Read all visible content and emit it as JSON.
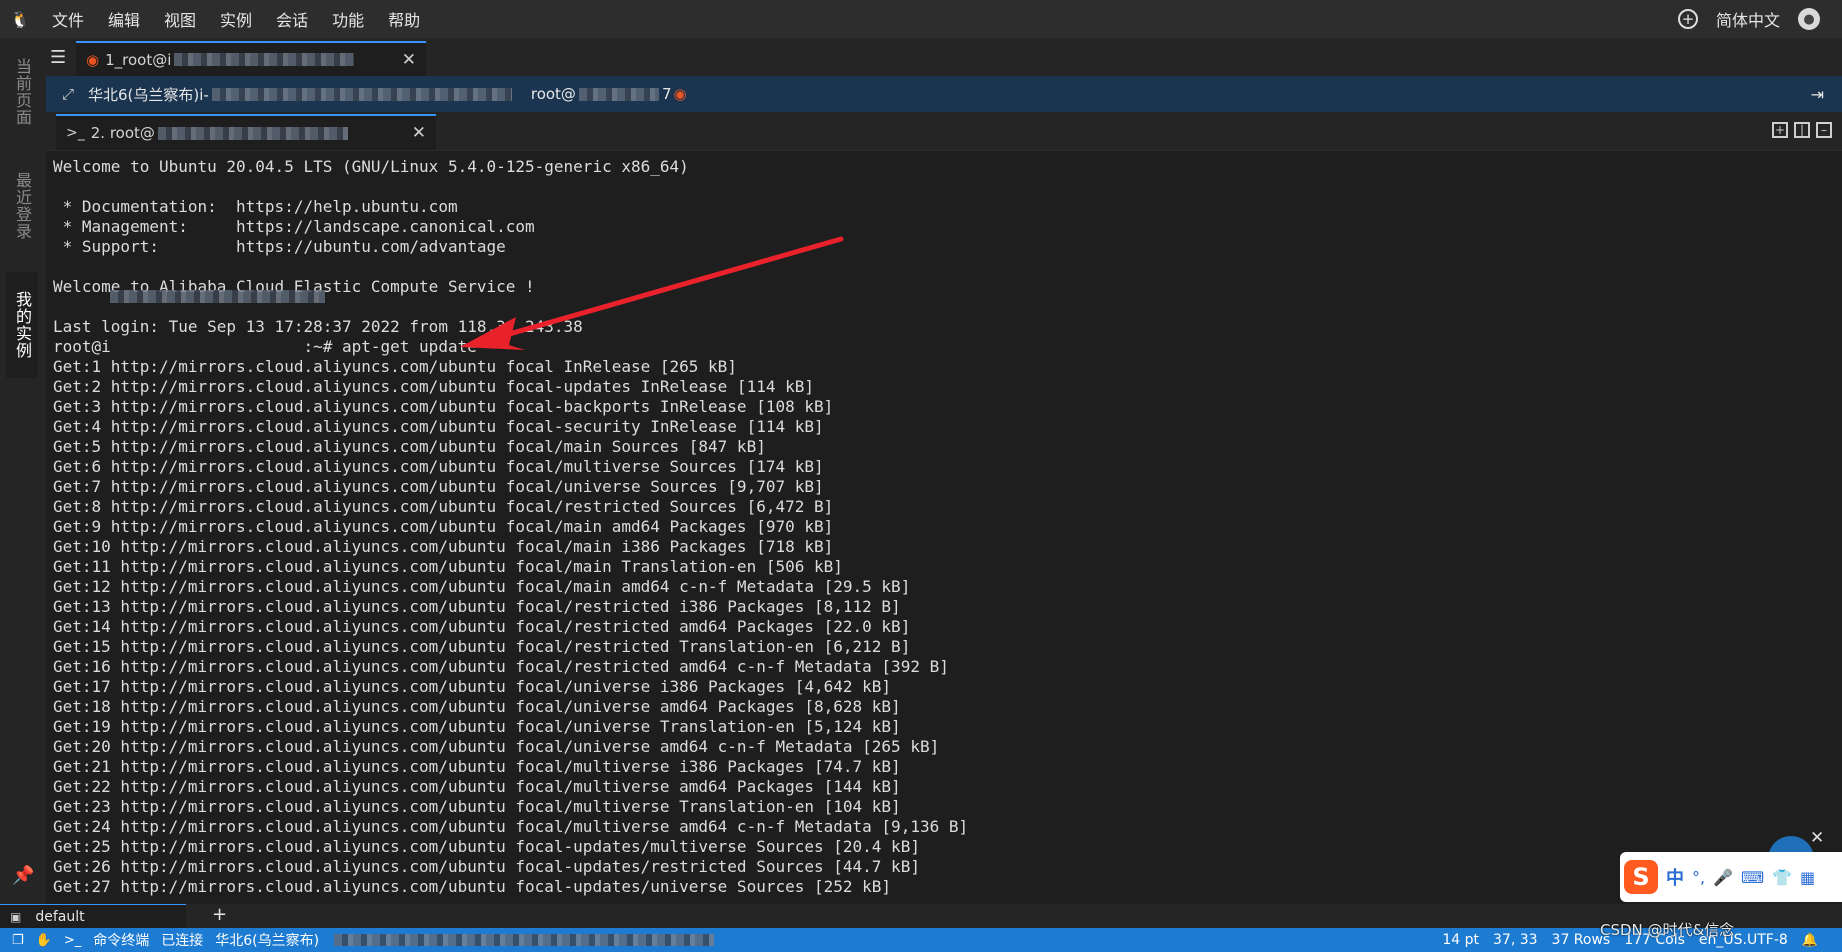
{
  "menu": {
    "items": [
      "文件",
      "编辑",
      "视图",
      "实例",
      "会话",
      "功能",
      "帮助"
    ],
    "language": "简体中文"
  },
  "sidebar": {
    "tabs": [
      "当前页面",
      "最近登录",
      "我的实例"
    ],
    "active": "我的实例"
  },
  "session_tab": {
    "label_prefix": "1_root@i"
  },
  "host_bar": {
    "region": "华北6(乌兰察布)i-",
    "user_prefix": "root@",
    "user_suffix": "7"
  },
  "terminal_tab": {
    "label_prefix": "2. root@"
  },
  "terminal": {
    "lines": [
      "Welcome to Ubuntu 20.04.5 LTS (GNU/Linux 5.4.0-125-generic x86_64)",
      "",
      " * Documentation:  https://help.ubuntu.com",
      " * Management:     https://landscape.canonical.com",
      " * Support:        https://ubuntu.com/advantage",
      "",
      "Welcome to Alibaba Cloud Elastic Compute Service !",
      "",
      "Last login: Tue Sep 13 17:28:37 2022 from 118.31.243.38",
      "root@i                    :~# apt-get update",
      "Get:1 http://mirrors.cloud.aliyuncs.com/ubuntu focal InRelease [265 kB]",
      "Get:2 http://mirrors.cloud.aliyuncs.com/ubuntu focal-updates InRelease [114 kB]",
      "Get:3 http://mirrors.cloud.aliyuncs.com/ubuntu focal-backports InRelease [108 kB]",
      "Get:4 http://mirrors.cloud.aliyuncs.com/ubuntu focal-security InRelease [114 kB]",
      "Get:5 http://mirrors.cloud.aliyuncs.com/ubuntu focal/main Sources [847 kB]",
      "Get:6 http://mirrors.cloud.aliyuncs.com/ubuntu focal/multiverse Sources [174 kB]",
      "Get:7 http://mirrors.cloud.aliyuncs.com/ubuntu focal/universe Sources [9,707 kB]",
      "Get:8 http://mirrors.cloud.aliyuncs.com/ubuntu focal/restricted Sources [6,472 B]",
      "Get:9 http://mirrors.cloud.aliyuncs.com/ubuntu focal/main amd64 Packages [970 kB]",
      "Get:10 http://mirrors.cloud.aliyuncs.com/ubuntu focal/main i386 Packages [718 kB]",
      "Get:11 http://mirrors.cloud.aliyuncs.com/ubuntu focal/main Translation-en [506 kB]",
      "Get:12 http://mirrors.cloud.aliyuncs.com/ubuntu focal/main amd64 c-n-f Metadata [29.5 kB]",
      "Get:13 http://mirrors.cloud.aliyuncs.com/ubuntu focal/restricted i386 Packages [8,112 B]",
      "Get:14 http://mirrors.cloud.aliyuncs.com/ubuntu focal/restricted amd64 Packages [22.0 kB]",
      "Get:15 http://mirrors.cloud.aliyuncs.com/ubuntu focal/restricted Translation-en [6,212 B]",
      "Get:16 http://mirrors.cloud.aliyuncs.com/ubuntu focal/restricted amd64 c-n-f Metadata [392 B]",
      "Get:17 http://mirrors.cloud.aliyuncs.com/ubuntu focal/universe i386 Packages [4,642 kB]",
      "Get:18 http://mirrors.cloud.aliyuncs.com/ubuntu focal/universe amd64 Packages [8,628 kB]",
      "Get:19 http://mirrors.cloud.aliyuncs.com/ubuntu focal/universe Translation-en [5,124 kB]",
      "Get:20 http://mirrors.cloud.aliyuncs.com/ubuntu focal/universe amd64 c-n-f Metadata [265 kB]",
      "Get:21 http://mirrors.cloud.aliyuncs.com/ubuntu focal/multiverse i386 Packages [74.7 kB]",
      "Get:22 http://mirrors.cloud.aliyuncs.com/ubuntu focal/multiverse amd64 Packages [144 kB]",
      "Get:23 http://mirrors.cloud.aliyuncs.com/ubuntu focal/multiverse Translation-en [104 kB]",
      "Get:24 http://mirrors.cloud.aliyuncs.com/ubuntu focal/multiverse amd64 c-n-f Metadata [9,136 B]",
      "Get:25 http://mirrors.cloud.aliyuncs.com/ubuntu focal-updates/multiverse Sources [20.4 kB]",
      "Get:26 http://mirrors.cloud.aliyuncs.com/ubuntu focal-updates/restricted Sources [44.7 kB]",
      "Get:27 http://mirrors.cloud.aliyuncs.com/ubuntu focal-updates/universe Sources [252 kB]"
    ]
  },
  "ime": {
    "label_zh": "中",
    "label_punct": "°,"
  },
  "bottom": {
    "tab_label": "default",
    "add_label": "+"
  },
  "status": {
    "left": [
      "命令终端",
      "已连接",
      "华北6(乌兰察布)"
    ],
    "right": [
      "14 pt",
      "37, 33",
      "37 Rows",
      "177 Cols",
      "en_US.UTF-8"
    ]
  },
  "watermark": "CSDN @时代&信念",
  "colors": {
    "accent": "#1d7bd2",
    "annotation": "#e8212b",
    "ubuntu": "#e95420",
    "ime_logo": "#ff5a1f"
  },
  "icons": [
    "linux-logo-icon",
    "plus-circle-icon",
    "user-avatar-icon",
    "hamburger-icon",
    "ubuntu-icon",
    "close-icon",
    "expand-icon",
    "exit-icon",
    "terminal-prompt-icon",
    "split-icons",
    "pin-icon",
    "terminal-icon",
    "sogou-ime-icon"
  ]
}
